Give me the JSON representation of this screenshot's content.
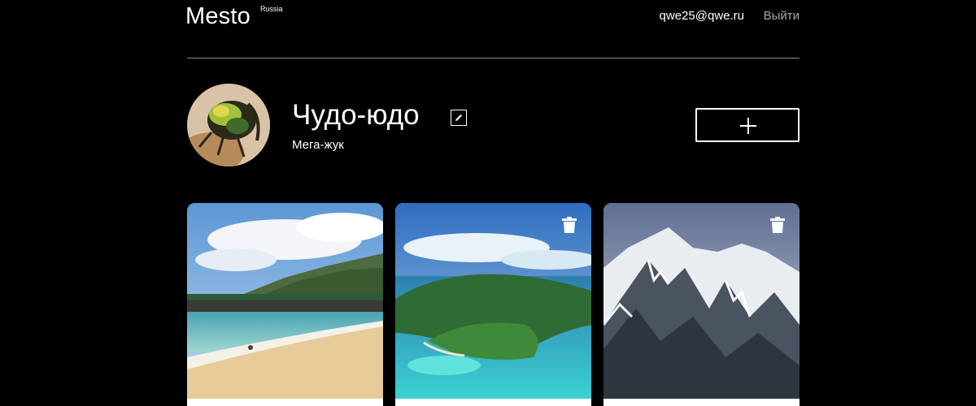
{
  "header": {
    "logo_text": "Mesto",
    "logo_sup": "Russia",
    "email": "qwe25@qwe.ru",
    "logout_label": "Выйти"
  },
  "profile": {
    "name": "Чудо-юдо",
    "about": "Мега-жук",
    "edit_icon": "pencil-icon",
    "add_icon": "plus-icon"
  },
  "cards": [
    {
      "scene": "tropical beach with mountains",
      "delete_icon": "trash-icon"
    },
    {
      "scene": "aerial view of tropical island",
      "delete_icon": "trash-icon"
    },
    {
      "scene": "snowy mountain range",
      "delete_icon": "trash-icon"
    }
  ],
  "colors": {
    "background": "#000000",
    "text": "#ffffff",
    "muted": "#a9a9a9",
    "divider": "#8a8a8a"
  }
}
